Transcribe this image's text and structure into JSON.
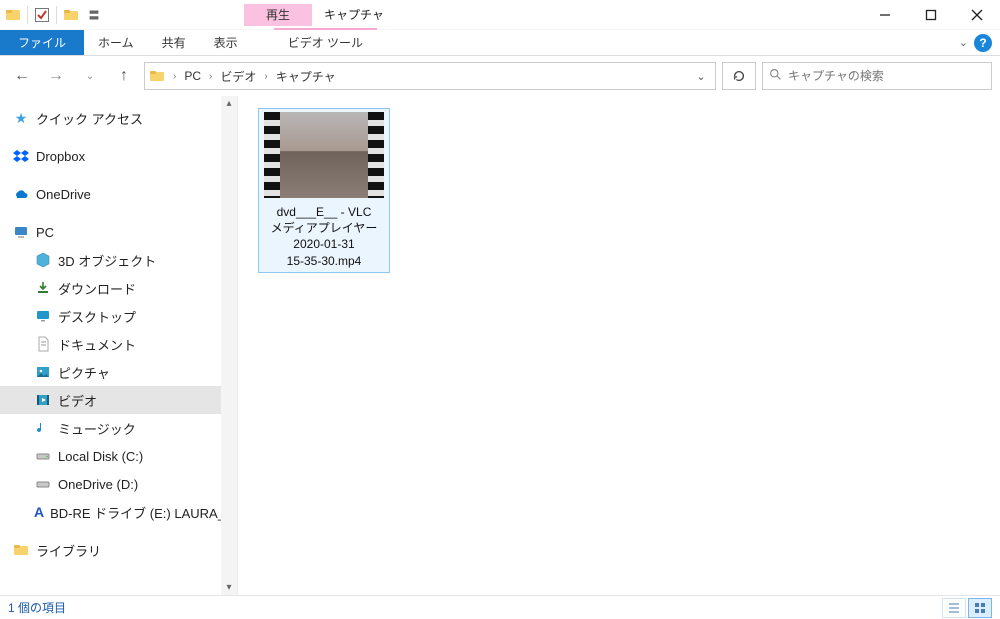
{
  "titlebar": {
    "context_tab": "再生",
    "window_title": "キャプチャ"
  },
  "ribbon": {
    "file": "ファイル",
    "tabs": [
      "ホーム",
      "共有",
      "表示"
    ],
    "context_tool": "ビデオ ツール"
  },
  "breadcrumb": {
    "parts": [
      "PC",
      "ビデオ",
      "キャプチャ"
    ]
  },
  "search": {
    "placeholder": "キャプチャの検索"
  },
  "sidebar": {
    "quick_access": "クイック アクセス",
    "dropbox": "Dropbox",
    "onedrive": "OneDrive",
    "pc": "PC",
    "pc_children": {
      "objects3d": "3D オブジェクト",
      "downloads": "ダウンロード",
      "desktop": "デスクトップ",
      "documents": "ドキュメント",
      "pictures": "ピクチャ",
      "videos": "ビデオ",
      "music": "ミュージック",
      "local_c": "Local Disk (C:)",
      "onedrive_d": "OneDrive (D:)",
      "bdre": "BD-RE ドライブ (E:) LAURA_RE"
    },
    "libraries": "ライブラリ"
  },
  "file": {
    "line1": "dvd___E__ - VLC",
    "line2": "メディアプレイヤー",
    "line3": "2020-01-31",
    "line4": "15-35-30.mp4"
  },
  "status": {
    "count_text": "1 個の項目"
  }
}
